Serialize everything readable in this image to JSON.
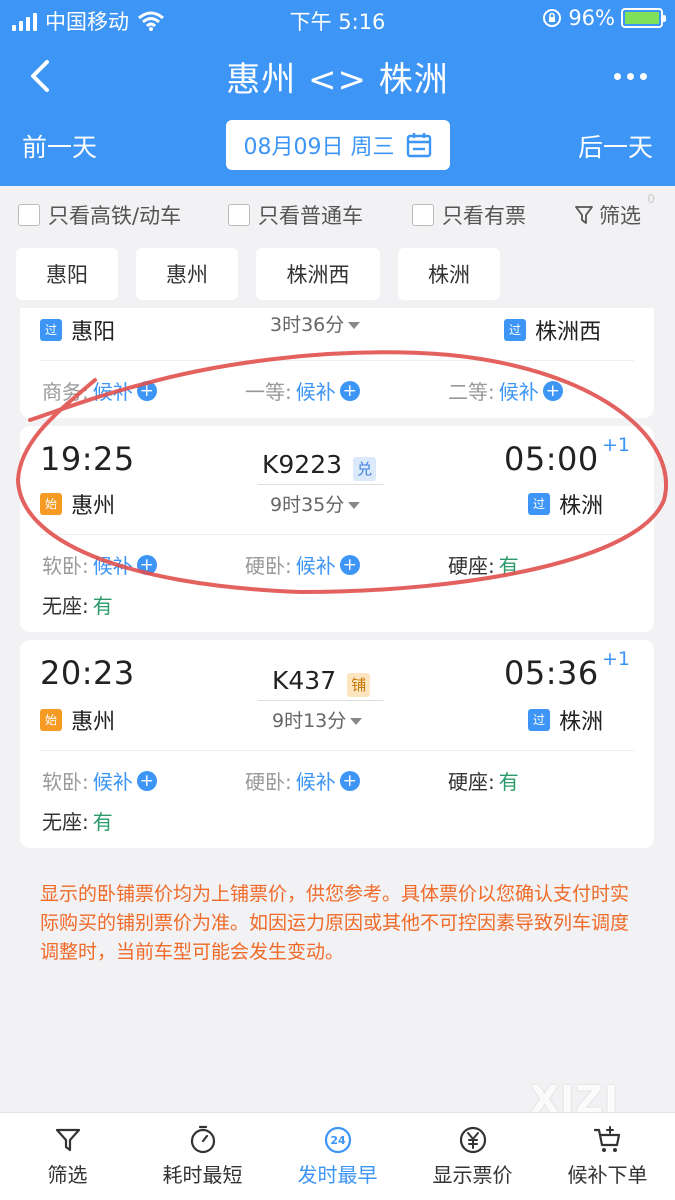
{
  "status_bar": {
    "carrier": "中国移动",
    "time": "下午 5:16",
    "battery": "96%"
  },
  "nav": {
    "title": "惠州 <> 株洲"
  },
  "date_bar": {
    "prev": "前一天",
    "date": "08月09日 周三",
    "next": "后一天"
  },
  "filters": {
    "high_speed": "只看高铁/动车",
    "normal": "只看普通车",
    "available": "只看有票",
    "filter_label": "筛选",
    "filter_count": "0"
  },
  "stations": [
    "惠阳",
    "惠州",
    "株洲西",
    "株洲"
  ],
  "trains": [
    {
      "from_badge": "过",
      "from": "惠阳",
      "duration": "3时36分",
      "to_badge": "过",
      "to": "株洲西",
      "seats": [
        {
          "label": "商务:",
          "value": "候补"
        },
        {
          "label": "一等:",
          "value": "候补"
        },
        {
          "label": "二等:",
          "value": "候补"
        }
      ]
    },
    {
      "depart": "19:25",
      "train_no": "K9223",
      "tag": "兑",
      "arrive": "05:00",
      "day_offset": "+1",
      "from_badge": "始",
      "from": "惠州",
      "duration": "9时35分",
      "to_badge": "过",
      "to": "株洲",
      "seats": [
        {
          "label": "软卧:",
          "value": "候补"
        },
        {
          "label": "硬卧:",
          "value": "候补"
        },
        {
          "label": "硬座:",
          "value": "有"
        },
        {
          "label": "无座:",
          "value": "有"
        }
      ]
    },
    {
      "depart": "20:23",
      "train_no": "K437",
      "tag": "铺",
      "arrive": "05:36",
      "day_offset": "+1",
      "from_badge": "始",
      "from": "惠州",
      "duration": "9时13分",
      "to_badge": "过",
      "to": "株洲",
      "seats": [
        {
          "label": "软卧:",
          "value": "候补"
        },
        {
          "label": "硬卧:",
          "value": "候补"
        },
        {
          "label": "硬座:",
          "value": "有"
        },
        {
          "label": "无座:",
          "value": "有"
        }
      ]
    }
  ],
  "notice": "显示的卧铺票价均为上铺票价，供您参考。具体票价以您确认支付时实际购买的铺别票价为准。如因运力原因或其他不可控因素导致列车调度调整时，当前车型可能会发生变动。",
  "watermark": "XIZI",
  "tabs": [
    {
      "label": "筛选",
      "icon": "filter-icon"
    },
    {
      "label": "耗时最短",
      "icon": "stopwatch-icon"
    },
    {
      "label": "发时最早",
      "icon": "clock-24-icon",
      "badge": "24"
    },
    {
      "label": "显示票价",
      "icon": "yuan-icon"
    },
    {
      "label": "候补下单",
      "icon": "cart-icon"
    }
  ],
  "colors": {
    "primary": "#3d95f6",
    "available": "#2a9a6a",
    "notice": "#f06a28",
    "origin_badge": "#f59a23"
  }
}
